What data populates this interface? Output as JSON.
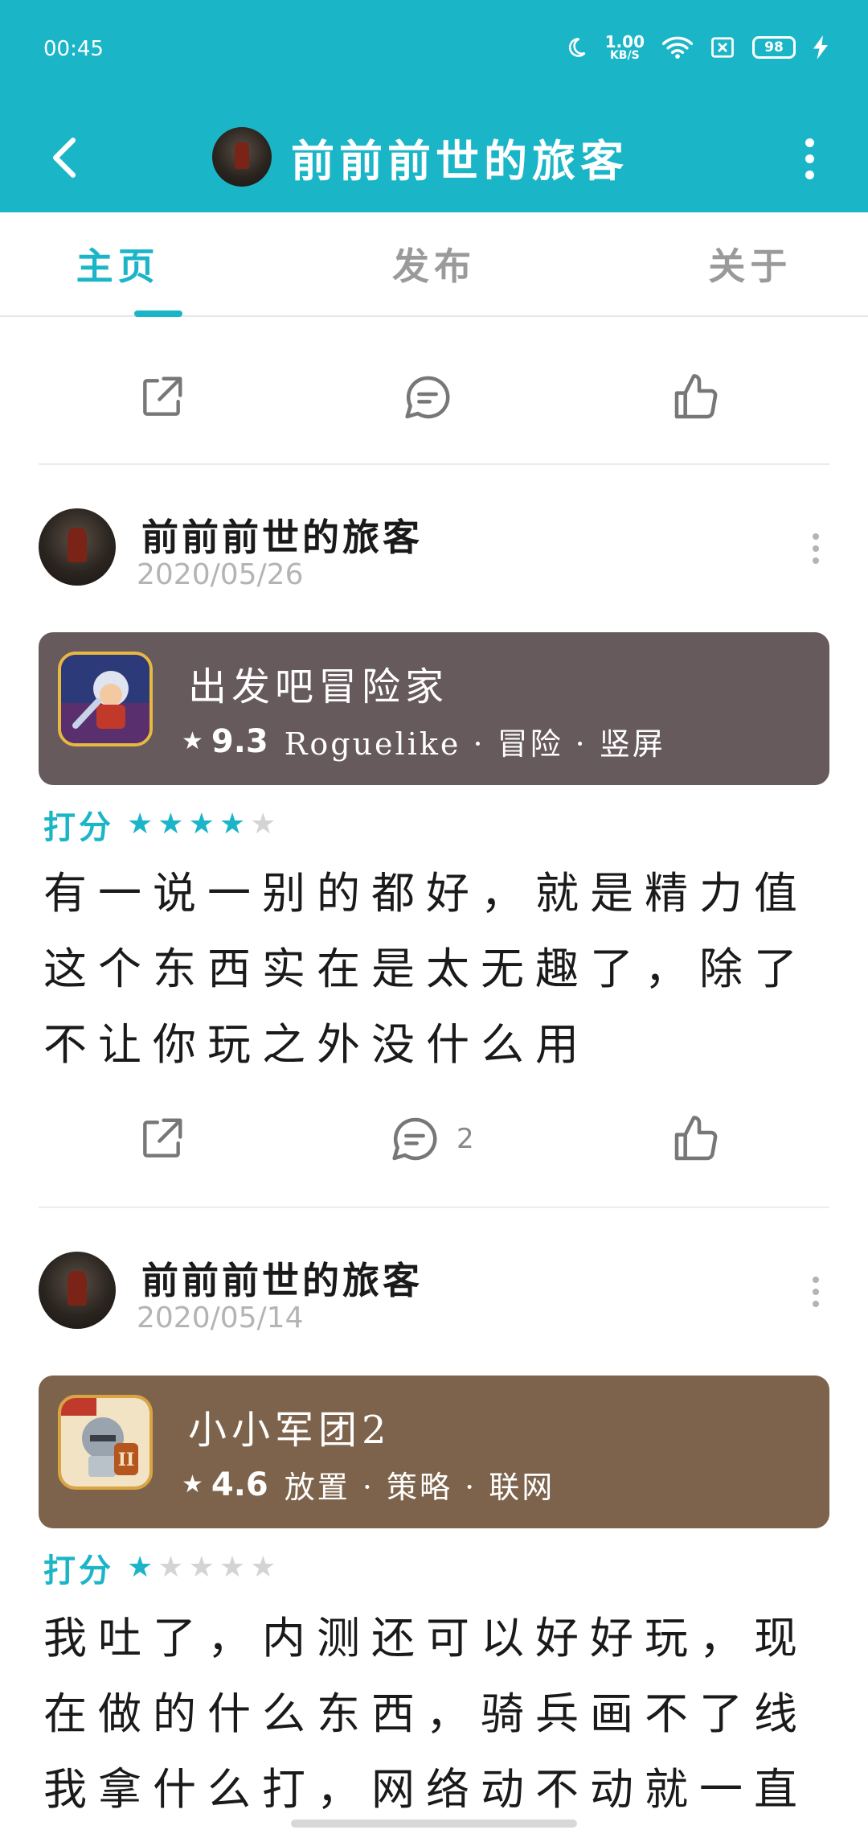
{
  "status_bar": {
    "time": "00:45",
    "net_speed_value": "1.00",
    "net_speed_unit": "KB/S",
    "battery": "98",
    "icons": [
      "moon-icon",
      "wifi-icon",
      "sim-off-icon",
      "battery-icon",
      "charging-icon"
    ]
  },
  "header": {
    "back_icon": "chevron-left-icon",
    "title": "前前前世的旅客",
    "more_icon": "more-vertical-icon"
  },
  "tabs": [
    {
      "label": "主页",
      "active": true
    },
    {
      "label": "发布",
      "active": false
    },
    {
      "label": "关于",
      "active": false
    }
  ],
  "feed": {
    "partial_text": "",
    "top_actions": {
      "share_icon": "share-icon",
      "comment_icon": "comment-icon",
      "like_icon": "thumbs-up-icon",
      "comment_count": ""
    },
    "posts": [
      {
        "author": "前前前世的旅客",
        "date": "2020/05/26",
        "game": {
          "name": "出发吧冒险家",
          "score": "9.3",
          "tags": "Roguelike · 冒险 · 竖屏",
          "card_color": "#665a5d"
        },
        "rating_label": "打分",
        "stars": 4,
        "review": "有一说一别的都好，就是精力值这个东西实在是太无趣了，除了不让你玩之外没什么用",
        "comment_count": "2"
      },
      {
        "author": "前前前世的旅客",
        "date": "2020/05/14",
        "game": {
          "name": "小小军团2",
          "score": "4.6",
          "tags": "放置 · 策略 · 联网",
          "card_color": "#7d634b"
        },
        "rating_label": "打分",
        "stars": 1,
        "review": "我吐了，内测还可以好好玩，现在做的什么东西，骑兵画不了线我拿什么打，网络动不动就一直转，我"
      }
    ]
  },
  "colors": {
    "accent": "#1bb5c8",
    "star_off": "#d4d4d4"
  }
}
